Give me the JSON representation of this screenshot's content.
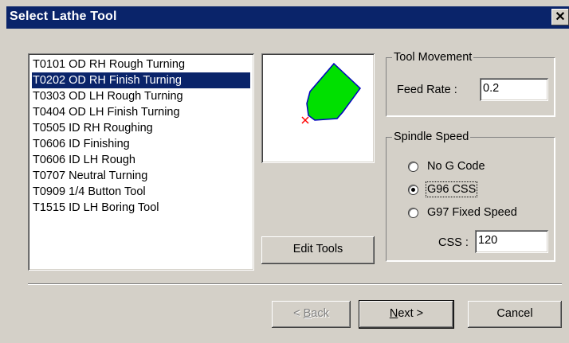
{
  "window": {
    "title": "Select Lathe Tool",
    "close_glyph": "✕"
  },
  "tools": [
    "T0101 OD RH Rough Turning",
    "T0202 OD RH Finish Turning",
    "T0303 OD LH Rough Turning",
    "T0404 OD LH Finish Turning",
    "T0505 ID RH Roughing",
    "T0606 ID Finishing",
    "T0606 ID LH Rough",
    "T0707 Neutral Turning",
    "T0909 1/4 Button Tool",
    "T1515 ID LH Boring Tool"
  ],
  "selected_tool_index": 1,
  "preview": {
    "insert_color": "#00e000",
    "outline_color": "#0000c0",
    "origin_marker_color": "#ff0000",
    "icon": "tool-insert-preview"
  },
  "edit_tools_label": "Edit Tools",
  "tool_movement": {
    "legend": "Tool Movement",
    "feed_rate_label": "Feed Rate :",
    "feed_rate_value": "0.2"
  },
  "spindle_speed": {
    "legend": "Spindle Speed",
    "options": [
      {
        "label": "No G Code",
        "selected": false
      },
      {
        "label": "G96 CSS",
        "selected": true
      },
      {
        "label": "G97 Fixed Speed",
        "selected": false
      }
    ],
    "css_label": "CSS :",
    "css_value": "120"
  },
  "buttons": {
    "back": {
      "prefix": "< ",
      "mnemonic": "B",
      "rest": "ack",
      "enabled": false
    },
    "next": {
      "mnemonic": "N",
      "rest": "ext >"
    },
    "cancel": "Cancel"
  },
  "colors": {
    "titlebar": "#0a246a",
    "face": "#d4d0c8",
    "selection": "#0a246a"
  }
}
